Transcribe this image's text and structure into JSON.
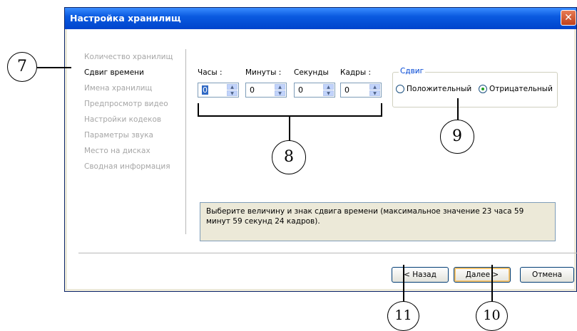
{
  "window": {
    "title": "Настройка хранилищ",
    "close_glyph": "✕"
  },
  "nav": {
    "items": [
      {
        "label": "Количество хранилищ",
        "active": false
      },
      {
        "label": "Сдвиг времени",
        "active": true
      },
      {
        "label": "Имена хранилищ",
        "active": false
      },
      {
        "label": "Предпросмотр видео",
        "active": false
      },
      {
        "label": "Настройки кодеков",
        "active": false
      },
      {
        "label": "Параметры звука",
        "active": false
      },
      {
        "label": "Место на дисках",
        "active": false
      },
      {
        "label": "Сводная информация",
        "active": false
      }
    ]
  },
  "fields": {
    "hours": {
      "label": "Часы :",
      "value": "0"
    },
    "minutes": {
      "label": "Минуты :",
      "value": "0"
    },
    "seconds": {
      "label": "Секунды",
      "value": "0"
    },
    "frames": {
      "label": "Кадры :",
      "value": "0"
    }
  },
  "shift_group": {
    "title": "Сдвиг",
    "positive_label": "Положительный",
    "negative_label": "Отрицательный",
    "selected": "negative"
  },
  "info_text": "Выберите величину и знак сдвига времени (максимальное значение 23 часа 59 минут 59 секунд 24 кадров).",
  "buttons": {
    "back": "< Назад",
    "next": "Далее >",
    "cancel": "Отмена"
  },
  "callouts": {
    "c7": "7",
    "c8": "8",
    "c9": "9",
    "c10": "10",
    "c11": "11"
  },
  "colors": {
    "titlebar": "#0a5ae0",
    "group_title": "#0046d5",
    "selection": "#316ac5"
  }
}
